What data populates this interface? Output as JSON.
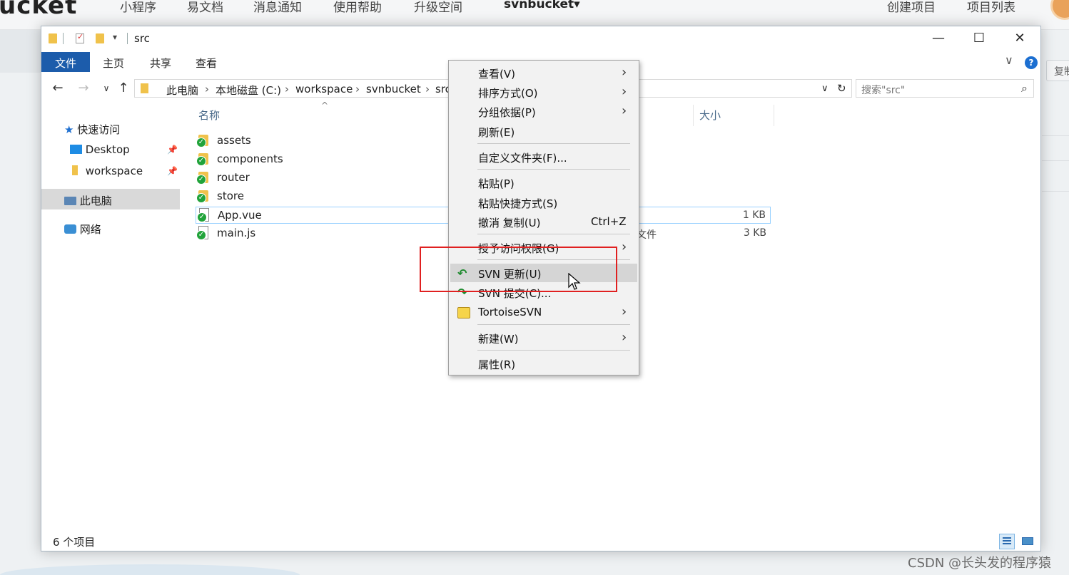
{
  "site": {
    "logo": "ucket",
    "nav": [
      "小程序",
      "易文档",
      "消息通知",
      "使用帮助",
      "升级空间"
    ],
    "user_menu": "svnbucket▾",
    "right_nav": [
      "创建项目",
      "项目列表"
    ],
    "side_button": "复制",
    "watermark": "CSDN @长头发的程序猿"
  },
  "window": {
    "title": "src",
    "controls": [
      "—",
      "☐",
      "✕"
    ],
    "ribbon_tabs": [
      "文件",
      "主页",
      "共享",
      "查看"
    ],
    "help_icon": "?",
    "expand_chevron": "∨"
  },
  "address": {
    "breadcrumbs": [
      "此电脑",
      "本地磁盘 (C:)",
      "workspace",
      "svnbucket",
      "src"
    ],
    "search_placeholder": "搜索\"src\""
  },
  "nav_pane": {
    "quick_access": "快速访问",
    "items": [
      {
        "label": "Desktop",
        "pinned": true
      },
      {
        "label": "workspace",
        "pinned": true
      }
    ],
    "this_pc": "此电脑",
    "network": "网络"
  },
  "columns": {
    "name": "名称",
    "size": "大小"
  },
  "files": [
    {
      "name": "assets",
      "type": "",
      "size": "",
      "kind": "folder"
    },
    {
      "name": "components",
      "type": "",
      "size": "",
      "kind": "folder"
    },
    {
      "name": "router",
      "type": "",
      "size": "",
      "kind": "folder"
    },
    {
      "name": "store",
      "type": "",
      "size": "",
      "kind": "folder"
    },
    {
      "name": "App.vue",
      "type": "",
      "size": "1 KB",
      "kind": "file"
    },
    {
      "name": "main.js",
      "type": "文件",
      "size": "3 KB",
      "kind": "file"
    }
  ],
  "status": {
    "count": "6 个项目"
  },
  "context_menu": {
    "items": [
      {
        "label": "查看(V)",
        "submenu": true
      },
      {
        "label": "排序方式(O)",
        "submenu": true
      },
      {
        "label": "分组依据(P)",
        "submenu": true
      },
      {
        "label": "刷新(E)"
      },
      {
        "label": "自定义文件夹(F)..."
      },
      {
        "label": "粘贴(P)"
      },
      {
        "label": "粘贴快捷方式(S)"
      },
      {
        "label": "撤消 复制(U)",
        "shortcut": "Ctrl+Z"
      },
      {
        "label": "授予访问权限(G)",
        "submenu": true
      },
      {
        "label": "SVN 更新(U)",
        "icon": "svn-update-icon",
        "highlighted": true
      },
      {
        "label": "SVN 提交(C)...",
        "icon": "svn-commit-icon"
      },
      {
        "label": "TortoiseSVN",
        "icon": "tortoisesvn-icon",
        "submenu": true
      },
      {
        "label": "新建(W)",
        "submenu": true
      },
      {
        "label": "属性(R)"
      }
    ]
  },
  "colors": {
    "accent": "#1c5cab",
    "svn_ok": "#21a33a",
    "annotation": "#e02020"
  }
}
